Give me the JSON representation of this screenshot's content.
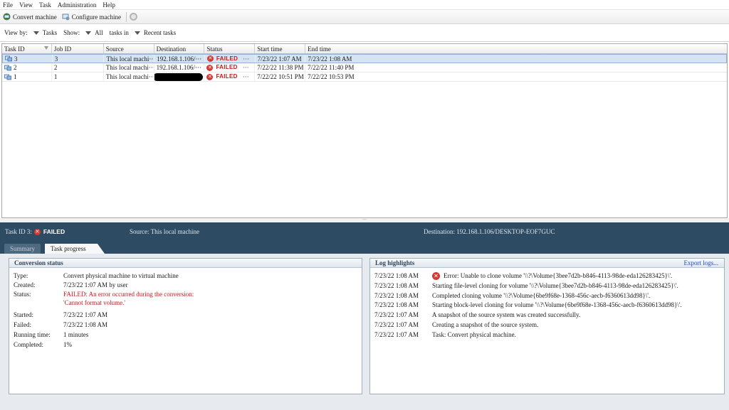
{
  "menu": [
    "File",
    "View",
    "Task",
    "Administration",
    "Help"
  ],
  "toolbar": {
    "convert_label": "Convert machine",
    "configure_label": "Configure machine"
  },
  "viewbar": {
    "view_by_label": "View by:",
    "view_by_value": "Tasks",
    "show_label": "Show:",
    "show_value": "All",
    "tasks_in_label": "tasks in",
    "tasks_in_value": "Recent tasks"
  },
  "table": {
    "headers": [
      "Task ID",
      "Job ID",
      "Source",
      "Destination",
      "Status",
      "Start time",
      "End time"
    ],
    "rows": [
      {
        "task_id": "3",
        "job_id": "3",
        "source": "This local machi···",
        "destination": "192.168.1.106/···",
        "status": "FAILED",
        "start": "7/23/22 1:07 AM",
        "end": "7/23/22 1:08 AM"
      },
      {
        "task_id": "2",
        "job_id": "2",
        "source": "This local machi···",
        "destination": "192.168.1.106/···",
        "status": "FAILED",
        "start": "7/22/22 11:38 PM",
        "end": "7/22/22 11:40 PM"
      },
      {
        "task_id": "1",
        "job_id": "1",
        "source": "This local machi···",
        "destination": "",
        "status": "FAILED",
        "start": "7/22/22 10:51 PM",
        "end": "7/22/22 10:53 PM"
      }
    ]
  },
  "splitter_glyph": "∙∙∙",
  "detail": {
    "task_label": "Task ID 3:",
    "status": "FAILED",
    "source": "Source:  This local machine",
    "destination": "Destination:  192.168.1.106/DESKTOP-EOF7GUC",
    "tabs": [
      "Summary",
      "Task progress"
    ]
  },
  "conversion": {
    "title": "Conversion status",
    "type_label": "Type:",
    "type_value": "Convert physical machine to virtual machine",
    "created_label": "Created:",
    "created_value": "7/23/22 1:07 AM by user",
    "status_label": "Status:",
    "status_value_1": "FAILED: An error occurred during the conversion:",
    "status_value_2": "'Cannot format volume.'",
    "started_label": "Started:",
    "started_value": "7/23/22 1:07 AM",
    "failed_label": "Failed:",
    "failed_value": "7/23/22 1:08 AM",
    "running_label": "Running time:",
    "running_value": "1 minutes",
    "completed_label": "Completed:",
    "completed_value": "1%"
  },
  "log": {
    "title": "Log highlights",
    "export_label": "Export logs...",
    "entries": [
      {
        "time": "7/23/22 1:08 AM",
        "msg": "Error: Unable to clone volume '\\\\?\\Volume{3bee7d2b-b846-4113-98de-eda126283425}\\'."
      },
      {
        "time": "7/23/22 1:08 AM",
        "msg": "Starting file-level cloning for volume '\\\\?\\Volume{3bee7d2b-b846-4113-98de-eda126283425}\\'."
      },
      {
        "time": "7/23/22 1:08 AM",
        "msg": "Completed cloning volume '\\\\?\\Volume{6be9f68e-1368-456c-aecb-f6360613dd98}\\'."
      },
      {
        "time": "7/23/22 1:08 AM",
        "msg": "Starting block-level cloning for volume '\\\\?\\Volume{6be9f68e-1368-456c-aecb-f6360613dd98}\\'."
      },
      {
        "time": "7/23/22 1:07 AM",
        "msg": "A snapshot of the source system was created successfully."
      },
      {
        "time": "7/23/22 1:07 AM",
        "msg": "Creating a snapshot of the source system."
      },
      {
        "time": "7/23/22 1:07 AM",
        "msg": "Task: Convert physical machine."
      }
    ]
  }
}
